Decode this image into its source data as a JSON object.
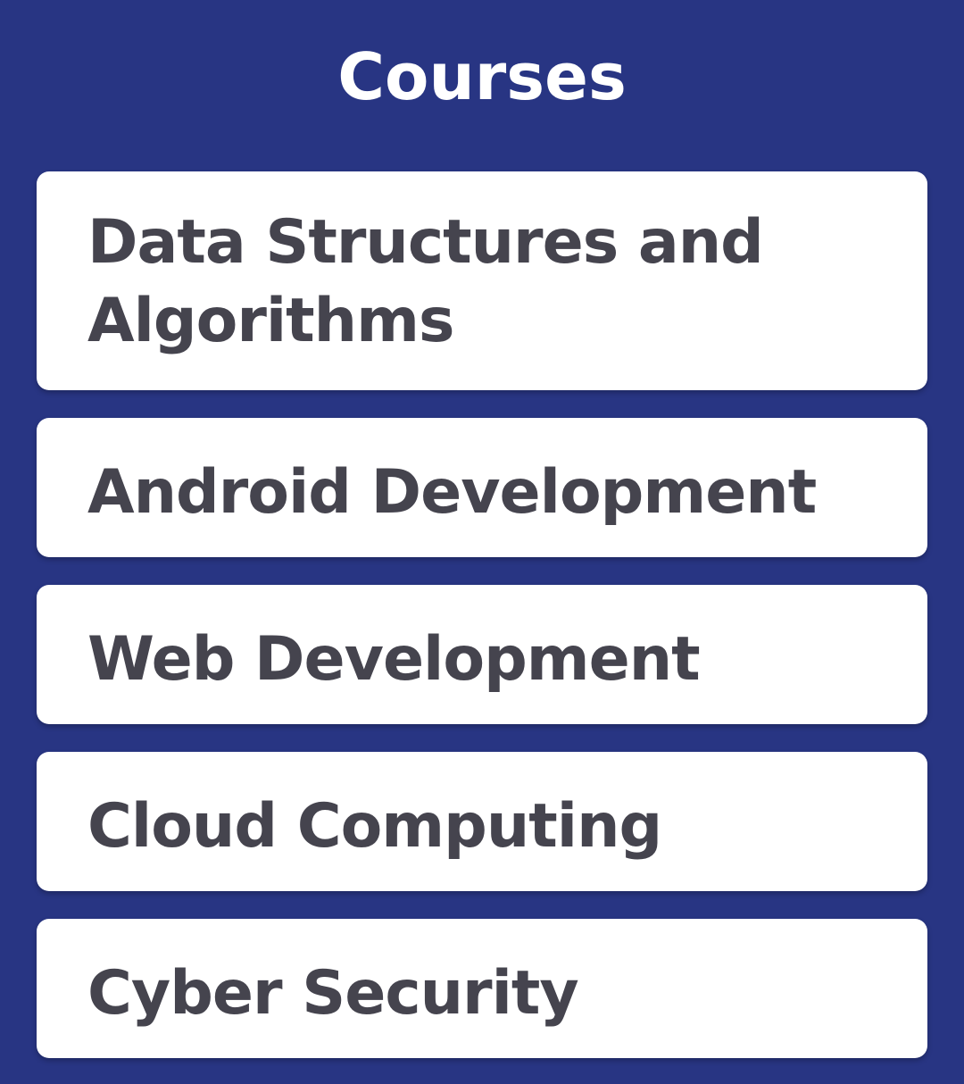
{
  "header": {
    "title": "Courses"
  },
  "courses": [
    {
      "label": "Data Structures and Algorithms"
    },
    {
      "label": "Android Development"
    },
    {
      "label": "Web Development"
    },
    {
      "label": "Cloud Computing"
    },
    {
      "label": "Cyber Security"
    }
  ],
  "colors": {
    "background": "#283583",
    "card": "#ffffff",
    "text": "#45444e",
    "title": "#ffffff"
  }
}
